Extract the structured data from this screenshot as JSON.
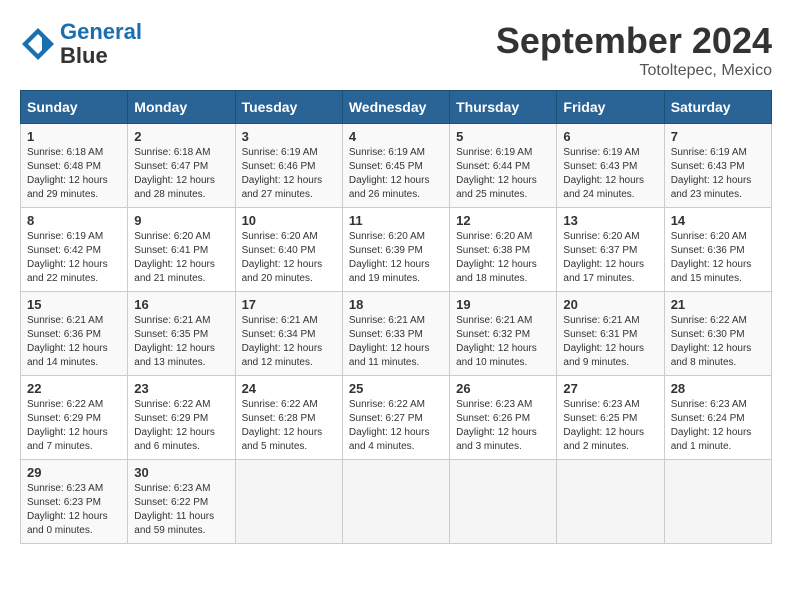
{
  "header": {
    "logo_line1": "General",
    "logo_line2": "Blue",
    "month": "September 2024",
    "location": "Totoltepec, Mexico"
  },
  "days_of_week": [
    "Sunday",
    "Monday",
    "Tuesday",
    "Wednesday",
    "Thursday",
    "Friday",
    "Saturday"
  ],
  "weeks": [
    [
      {
        "day": 1,
        "info": "Sunrise: 6:18 AM\nSunset: 6:48 PM\nDaylight: 12 hours\nand 29 minutes."
      },
      {
        "day": 2,
        "info": "Sunrise: 6:18 AM\nSunset: 6:47 PM\nDaylight: 12 hours\nand 28 minutes."
      },
      {
        "day": 3,
        "info": "Sunrise: 6:19 AM\nSunset: 6:46 PM\nDaylight: 12 hours\nand 27 minutes."
      },
      {
        "day": 4,
        "info": "Sunrise: 6:19 AM\nSunset: 6:45 PM\nDaylight: 12 hours\nand 26 minutes."
      },
      {
        "day": 5,
        "info": "Sunrise: 6:19 AM\nSunset: 6:44 PM\nDaylight: 12 hours\nand 25 minutes."
      },
      {
        "day": 6,
        "info": "Sunrise: 6:19 AM\nSunset: 6:43 PM\nDaylight: 12 hours\nand 24 minutes."
      },
      {
        "day": 7,
        "info": "Sunrise: 6:19 AM\nSunset: 6:43 PM\nDaylight: 12 hours\nand 23 minutes."
      }
    ],
    [
      {
        "day": 8,
        "info": "Sunrise: 6:19 AM\nSunset: 6:42 PM\nDaylight: 12 hours\nand 22 minutes."
      },
      {
        "day": 9,
        "info": "Sunrise: 6:20 AM\nSunset: 6:41 PM\nDaylight: 12 hours\nand 21 minutes."
      },
      {
        "day": 10,
        "info": "Sunrise: 6:20 AM\nSunset: 6:40 PM\nDaylight: 12 hours\nand 20 minutes."
      },
      {
        "day": 11,
        "info": "Sunrise: 6:20 AM\nSunset: 6:39 PM\nDaylight: 12 hours\nand 19 minutes."
      },
      {
        "day": 12,
        "info": "Sunrise: 6:20 AM\nSunset: 6:38 PM\nDaylight: 12 hours\nand 18 minutes."
      },
      {
        "day": 13,
        "info": "Sunrise: 6:20 AM\nSunset: 6:37 PM\nDaylight: 12 hours\nand 17 minutes."
      },
      {
        "day": 14,
        "info": "Sunrise: 6:20 AM\nSunset: 6:36 PM\nDaylight: 12 hours\nand 15 minutes."
      }
    ],
    [
      {
        "day": 15,
        "info": "Sunrise: 6:21 AM\nSunset: 6:36 PM\nDaylight: 12 hours\nand 14 minutes."
      },
      {
        "day": 16,
        "info": "Sunrise: 6:21 AM\nSunset: 6:35 PM\nDaylight: 12 hours\nand 13 minutes."
      },
      {
        "day": 17,
        "info": "Sunrise: 6:21 AM\nSunset: 6:34 PM\nDaylight: 12 hours\nand 12 minutes."
      },
      {
        "day": 18,
        "info": "Sunrise: 6:21 AM\nSunset: 6:33 PM\nDaylight: 12 hours\nand 11 minutes."
      },
      {
        "day": 19,
        "info": "Sunrise: 6:21 AM\nSunset: 6:32 PM\nDaylight: 12 hours\nand 10 minutes."
      },
      {
        "day": 20,
        "info": "Sunrise: 6:21 AM\nSunset: 6:31 PM\nDaylight: 12 hours\nand 9 minutes."
      },
      {
        "day": 21,
        "info": "Sunrise: 6:22 AM\nSunset: 6:30 PM\nDaylight: 12 hours\nand 8 minutes."
      }
    ],
    [
      {
        "day": 22,
        "info": "Sunrise: 6:22 AM\nSunset: 6:29 PM\nDaylight: 12 hours\nand 7 minutes."
      },
      {
        "day": 23,
        "info": "Sunrise: 6:22 AM\nSunset: 6:29 PM\nDaylight: 12 hours\nand 6 minutes."
      },
      {
        "day": 24,
        "info": "Sunrise: 6:22 AM\nSunset: 6:28 PM\nDaylight: 12 hours\nand 5 minutes."
      },
      {
        "day": 25,
        "info": "Sunrise: 6:22 AM\nSunset: 6:27 PM\nDaylight: 12 hours\nand 4 minutes."
      },
      {
        "day": 26,
        "info": "Sunrise: 6:23 AM\nSunset: 6:26 PM\nDaylight: 12 hours\nand 3 minutes."
      },
      {
        "day": 27,
        "info": "Sunrise: 6:23 AM\nSunset: 6:25 PM\nDaylight: 12 hours\nand 2 minutes."
      },
      {
        "day": 28,
        "info": "Sunrise: 6:23 AM\nSunset: 6:24 PM\nDaylight: 12 hours\nand 1 minute."
      }
    ],
    [
      {
        "day": 29,
        "info": "Sunrise: 6:23 AM\nSunset: 6:23 PM\nDaylight: 12 hours\nand 0 minutes."
      },
      {
        "day": 30,
        "info": "Sunrise: 6:23 AM\nSunset: 6:22 PM\nDaylight: 11 hours\nand 59 minutes."
      },
      null,
      null,
      null,
      null,
      null
    ]
  ]
}
